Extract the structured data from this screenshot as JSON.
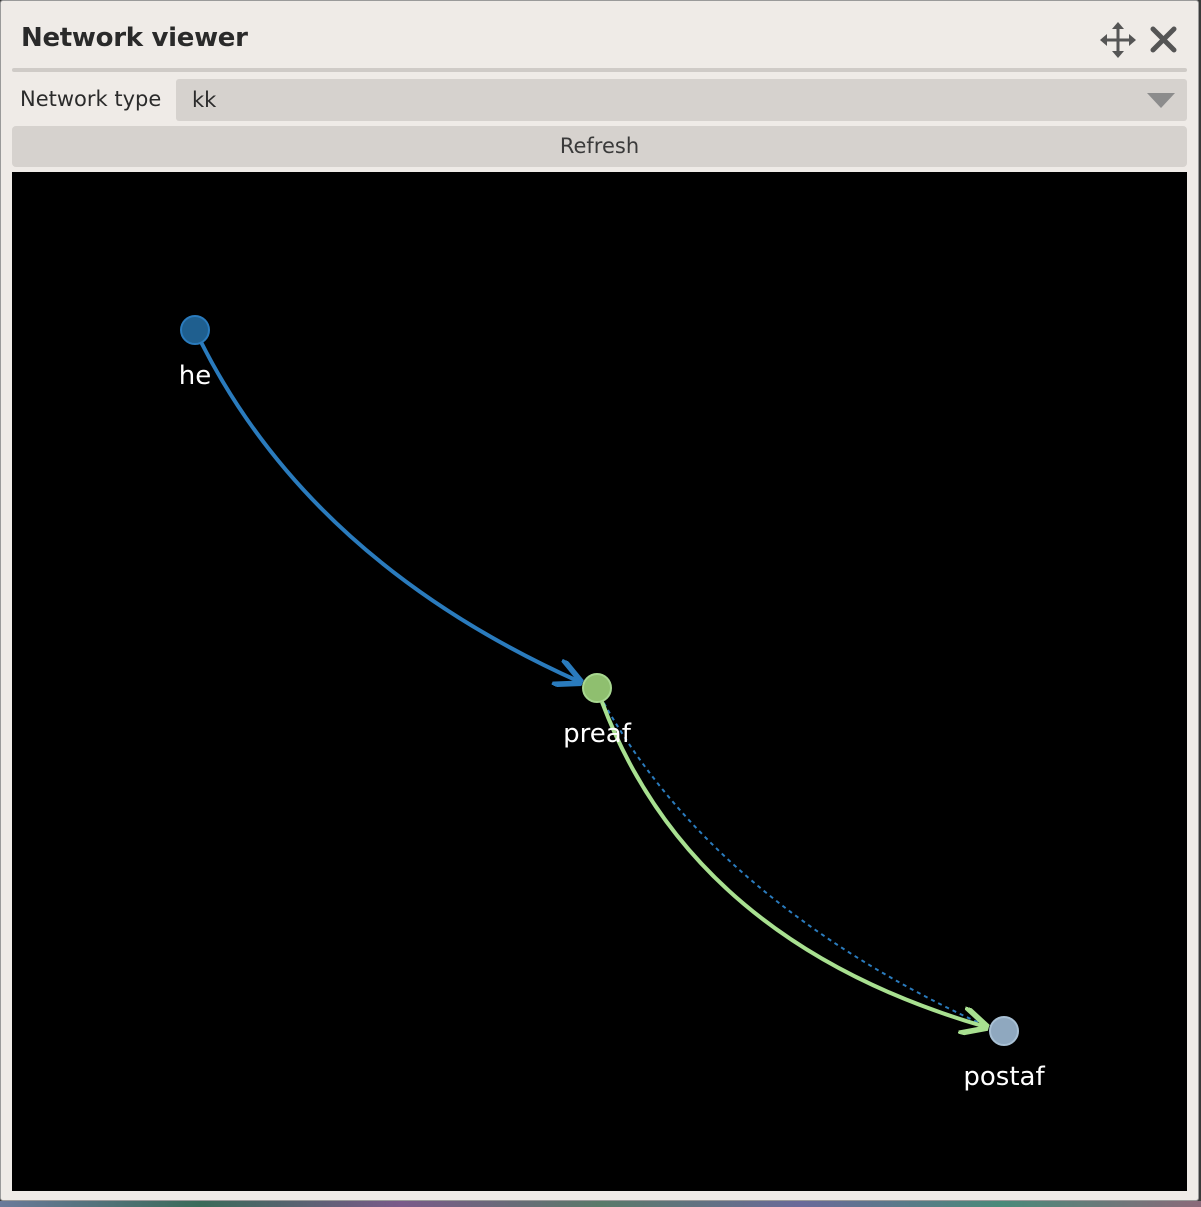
{
  "window": {
    "title": "Network viewer"
  },
  "controls": {
    "network_type_label": "Network type",
    "network_type_value": "kk",
    "refresh_label": "Refresh"
  },
  "icons": {
    "move": "move-arrows-icon",
    "close": "close-x-icon",
    "dropdown": "chevron-down-icon"
  },
  "colors": {
    "panel_bg": "#efebe7",
    "canvas_bg": "#000000",
    "node_he": "#1f5f8f",
    "node_preaf": "#8fbf6f",
    "node_postaf": "#8fa8bf",
    "edge_he_preaf": "#2a7bbd",
    "edge_preaf_postaf": "#a8e090",
    "edge_dotted": "#2a7bbd"
  },
  "network": {
    "nodes": [
      {
        "id": "he",
        "label": "he"
      },
      {
        "id": "preaf",
        "label": "preaf"
      },
      {
        "id": "postaf",
        "label": "postaf"
      }
    ],
    "edges": [
      {
        "source": "he",
        "target": "preaf",
        "style": "solid"
      },
      {
        "source": "preaf",
        "target": "postaf",
        "style": "solid"
      },
      {
        "source": "preaf",
        "target": "postaf",
        "style": "dotted"
      }
    ]
  }
}
